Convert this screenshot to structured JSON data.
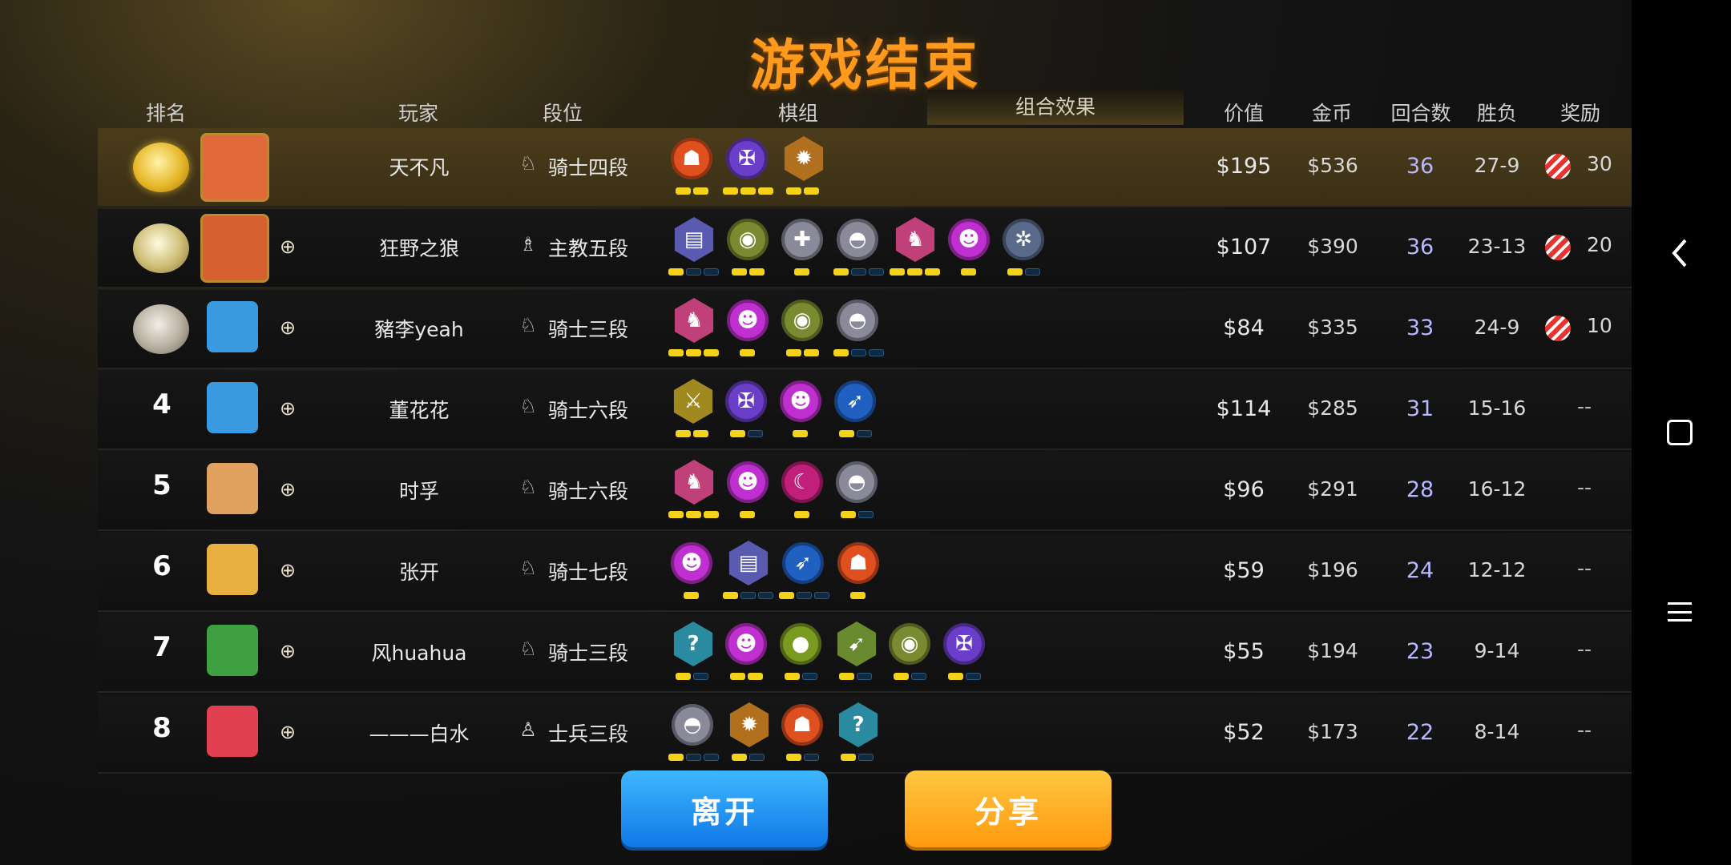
{
  "title": "游戏结束",
  "headers": {
    "rank": "排名",
    "player": "玩家",
    "tier": "段位",
    "pieces": "棋组",
    "combo": "组合效果",
    "value": "价值",
    "gold": "金币",
    "rounds": "回合数",
    "record": "胜负",
    "reward": "奖励"
  },
  "players": [
    {
      "rank": "1",
      "medal": "gold",
      "name": "天不凡",
      "tier_icon": "knight",
      "tier": "骑士四段",
      "value": "$195",
      "gold": "$536",
      "rounds": "36",
      "record": "27-9",
      "reward": "30",
      "friend": false,
      "combos": [
        {
          "icon": "demon",
          "shape": "circle",
          "color": "#e0501e",
          "pips": [
            1,
            1
          ]
        },
        {
          "icon": "fish",
          "shape": "circle",
          "color": "#6a3ec8",
          "pips": [
            1,
            1,
            1
          ]
        },
        {
          "icon": "gear",
          "shape": "hex",
          "color": "#b0701e",
          "pips": [
            1,
            1
          ]
        }
      ]
    },
    {
      "rank": "2",
      "medal": "silver",
      "name": "狂野之狼",
      "tier_icon": "bishop",
      "tier": "主教五段",
      "value": "$107",
      "gold": "$390",
      "rounds": "36",
      "record": "23-13",
      "reward": "20",
      "friend": true,
      "combos": [
        {
          "icon": "tablet",
          "shape": "hex",
          "color": "#5a5ab0",
          "pips": [
            1,
            0,
            0
          ]
        },
        {
          "icon": "goblin",
          "shape": "circle",
          "color": "#7a8a30",
          "pips": [
            1,
            1
          ]
        },
        {
          "icon": "cross",
          "shape": "circle",
          "color": "#8a8a9a",
          "pips": [
            1
          ]
        },
        {
          "icon": "helmet",
          "shape": "circle",
          "color": "#8a8a9a",
          "pips": [
            1,
            0,
            0
          ]
        },
        {
          "icon": "knight",
          "shape": "hex",
          "color": "#c0407a",
          "pips": [
            1,
            1,
            1
          ]
        },
        {
          "icon": "imp",
          "shape": "circle",
          "color": "#c030d0",
          "pips": [
            1
          ]
        },
        {
          "icon": "troll",
          "shape": "circle",
          "color": "#5a6a8a",
          "pips": [
            1,
            0
          ]
        }
      ]
    },
    {
      "rank": "3",
      "medal": "bronze",
      "name": "豬李yeah",
      "tier_icon": "knight",
      "tier": "骑士三段",
      "value": "$84",
      "gold": "$335",
      "rounds": "33",
      "record": "24-9",
      "reward": "10",
      "friend": true,
      "combos": [
        {
          "icon": "knight",
          "shape": "hex",
          "color": "#c0407a",
          "pips": [
            1,
            1,
            1
          ]
        },
        {
          "icon": "imp",
          "shape": "circle",
          "color": "#c030d0",
          "pips": [
            1
          ]
        },
        {
          "icon": "goblin",
          "shape": "circle",
          "color": "#7a8a30",
          "pips": [
            1,
            1
          ]
        },
        {
          "icon": "helmet",
          "shape": "circle",
          "color": "#8a8a9a",
          "pips": [
            1,
            0,
            0
          ]
        }
      ]
    },
    {
      "rank": "4",
      "medal": "",
      "name": "董花花",
      "tier_icon": "knight",
      "tier": "骑士六段",
      "value": "$114",
      "gold": "$285",
      "rounds": "31",
      "record": "15-16",
      "reward": "--",
      "friend": true,
      "combos": [
        {
          "icon": "swords",
          "shape": "hex",
          "color": "#a08a20",
          "pips": [
            1,
            1
          ]
        },
        {
          "icon": "fish",
          "shape": "circle",
          "color": "#6a3ec8",
          "pips": [
            1,
            0
          ]
        },
        {
          "icon": "imp",
          "shape": "circle",
          "color": "#c030d0",
          "pips": [
            1
          ]
        },
        {
          "icon": "feather",
          "shape": "circle",
          "color": "#2060c0",
          "pips": [
            1,
            0
          ]
        }
      ]
    },
    {
      "rank": "5",
      "medal": "",
      "name": "时孚",
      "tier_icon": "knight",
      "tier": "骑士六段",
      "value": "$96",
      "gold": "$291",
      "rounds": "28",
      "record": "16-12",
      "reward": "--",
      "friend": true,
      "combos": [
        {
          "icon": "knight",
          "shape": "hex",
          "color": "#c0407a",
          "pips": [
            1,
            1,
            1
          ]
        },
        {
          "icon": "imp",
          "shape": "circle",
          "color": "#c030d0",
          "pips": [
            1
          ]
        },
        {
          "icon": "claw",
          "shape": "circle",
          "color": "#c0207a",
          "pips": [
            1
          ]
        },
        {
          "icon": "helmet",
          "shape": "circle",
          "color": "#8a8a9a",
          "pips": [
            1,
            0
          ]
        }
      ]
    },
    {
      "rank": "6",
      "medal": "",
      "name": "张开",
      "tier_icon": "knight",
      "tier": "骑士七段",
      "value": "$59",
      "gold": "$196",
      "rounds": "24",
      "record": "12-12",
      "reward": "--",
      "friend": true,
      "combos": [
        {
          "icon": "imp",
          "shape": "circle",
          "color": "#c030d0",
          "pips": [
            1
          ]
        },
        {
          "icon": "tablet",
          "shape": "hex",
          "color": "#5a5ab0",
          "pips": [
            1,
            0,
            0
          ]
        },
        {
          "icon": "feather",
          "shape": "circle",
          "color": "#2060c0",
          "pips": [
            1,
            0,
            0
          ]
        },
        {
          "icon": "demon",
          "shape": "circle",
          "color": "#e0501e",
          "pips": [
            1
          ]
        }
      ]
    },
    {
      "rank": "7",
      "medal": "",
      "name": "风huahua",
      "tier_icon": "knight",
      "tier": "骑士三段",
      "value": "$55",
      "gold": "$194",
      "rounds": "23",
      "record": "9-14",
      "reward": "--",
      "friend": true,
      "combos": [
        {
          "icon": "question",
          "shape": "hex",
          "color": "#2a8aa0",
          "pips": [
            1,
            0
          ]
        },
        {
          "icon": "imp",
          "shape": "circle",
          "color": "#c030d0",
          "pips": [
            1,
            1
          ]
        },
        {
          "icon": "lump",
          "shape": "circle",
          "color": "#7a9a20",
          "pips": [
            1,
            0
          ]
        },
        {
          "icon": "bow",
          "shape": "hex",
          "color": "#6a8a30",
          "pips": [
            1,
            0
          ]
        },
        {
          "icon": "goblin",
          "shape": "circle",
          "color": "#7a8a30",
          "pips": [
            1,
            0
          ]
        },
        {
          "icon": "fish",
          "shape": "circle",
          "color": "#6a3ec8",
          "pips": [
            1,
            0
          ]
        }
      ]
    },
    {
      "rank": "8",
      "medal": "",
      "name": "———白水",
      "tier_icon": "pawn",
      "tier": "士兵三段",
      "value": "$52",
      "gold": "$173",
      "rounds": "22",
      "record": "8-14",
      "reward": "--",
      "friend": true,
      "combos": [
        {
          "icon": "helmet",
          "shape": "circle",
          "color": "#8a8a9a",
          "pips": [
            1,
            0,
            0
          ]
        },
        {
          "icon": "gear",
          "shape": "hex",
          "color": "#b0701e",
          "pips": [
            1,
            0
          ]
        },
        {
          "icon": "demon",
          "shape": "circle",
          "color": "#e0501e",
          "pips": [
            1,
            0
          ]
        },
        {
          "icon": "question",
          "shape": "hex",
          "color": "#2a8aa0",
          "pips": [
            1,
            0
          ]
        }
      ]
    }
  ],
  "buttons": {
    "leave": "离开",
    "share": "分享"
  },
  "nav": {
    "back": "back-icon",
    "home": "home-icon",
    "menu": "menu-icon"
  }
}
